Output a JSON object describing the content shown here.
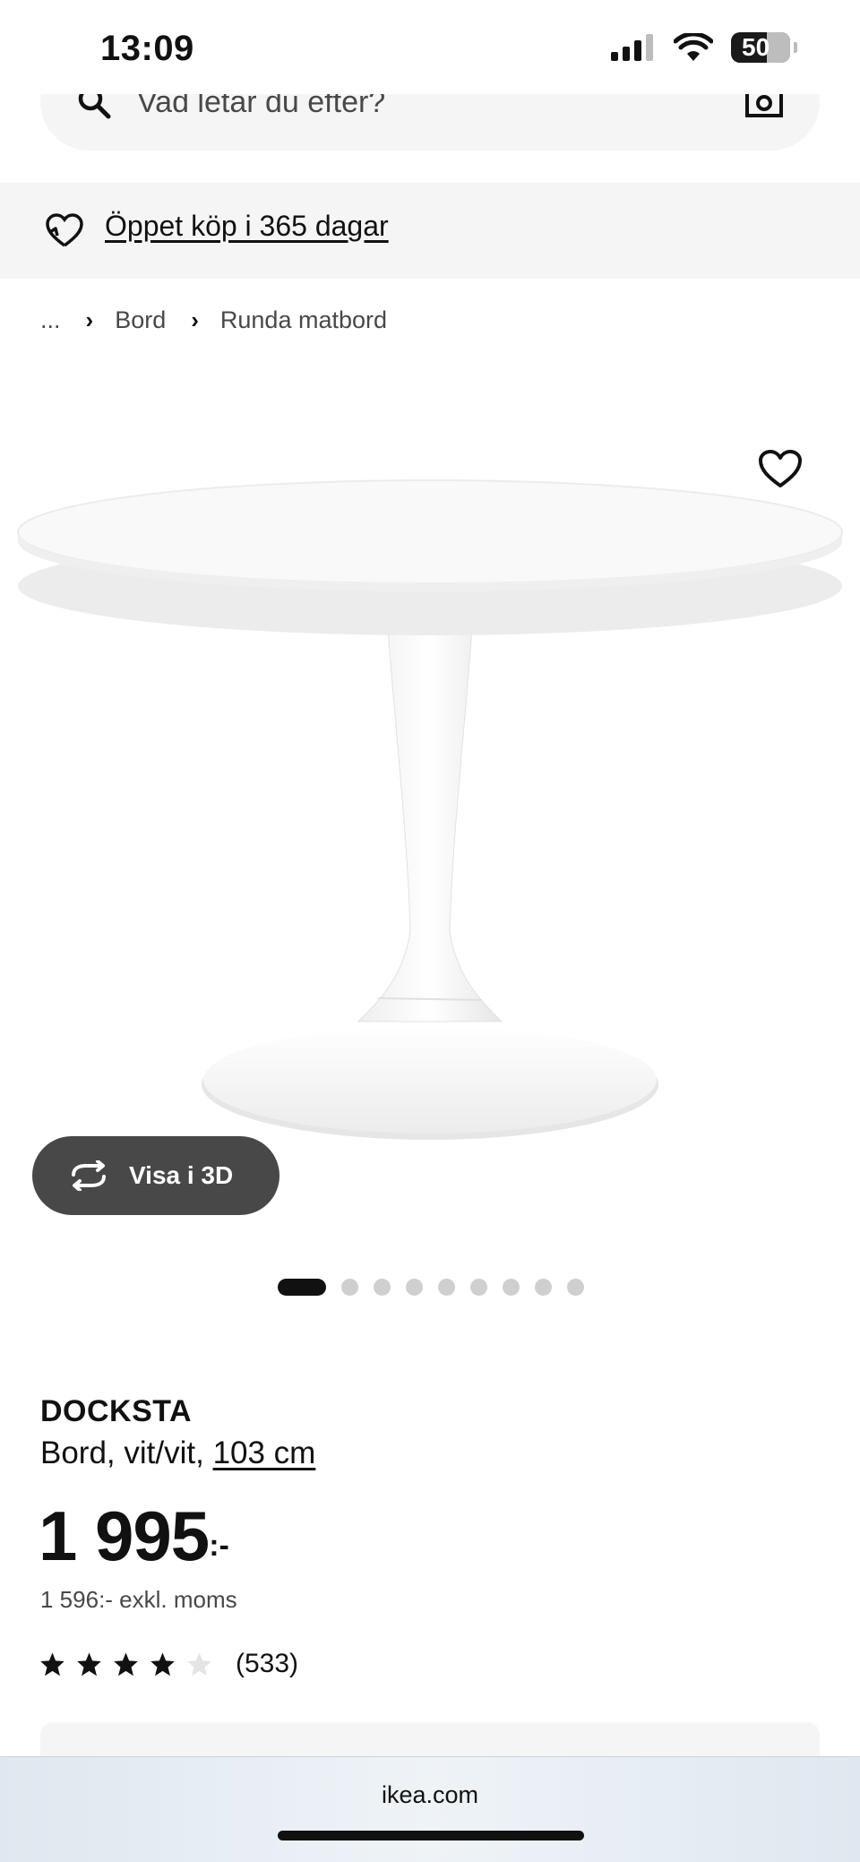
{
  "status_bar": {
    "time": "13:09",
    "battery": "50"
  },
  "search": {
    "placeholder": "Vad letar du efter?"
  },
  "promo": {
    "text": "Öppet köp i 365 dagar"
  },
  "breadcrumb": {
    "ellipsis": "...",
    "items": [
      "Bord",
      "Runda matbord"
    ]
  },
  "gallery": {
    "view_3d_label": "Visa i 3D",
    "total_images": 9,
    "active_index": 0
  },
  "product": {
    "name": "DOCKSTA",
    "description": "Bord, vit/vit,",
    "size": "103 cm",
    "price": "1 995",
    "price_suffix": ":-",
    "price_excl_vat": "1 596:- exkl. moms",
    "rating_value": 4,
    "rating_max": 5,
    "rating_count": "(533)"
  },
  "browser": {
    "url": "ikea.com"
  },
  "colors": {
    "accent_dark": "#111111",
    "button_gray": "#484848",
    "panel_gray": "#f5f5f5"
  }
}
